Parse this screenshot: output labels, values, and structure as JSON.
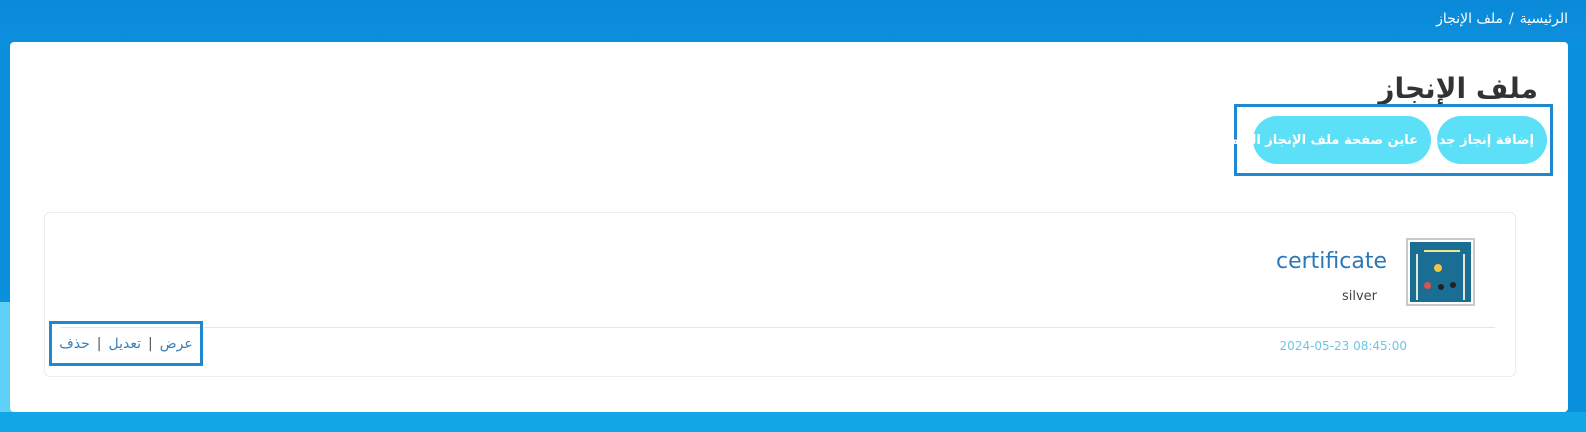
{
  "breadcrumb": {
    "home": "الرئيسية",
    "separator": "/",
    "current": "ملف الإنجاز"
  },
  "page": {
    "title": "ملف الإنجاز"
  },
  "actions": {
    "add_label": "إضافة إنجاز جديد",
    "view_public_label": "عاين صفحة ملف الإنجاز العامة"
  },
  "items": [
    {
      "title": "certificate",
      "subtitle": "silver",
      "date": "2024-05-23 08:45:00",
      "view_label": "عرض",
      "edit_label": "تعديل",
      "delete_label": "حذف",
      "separator": "|"
    }
  ],
  "colors": {
    "header": "#0a8fdc",
    "button": "#5be0f7",
    "highlight_border": "#1e88d0",
    "title_link": "#2b78b8",
    "date": "#6cc7e6"
  }
}
